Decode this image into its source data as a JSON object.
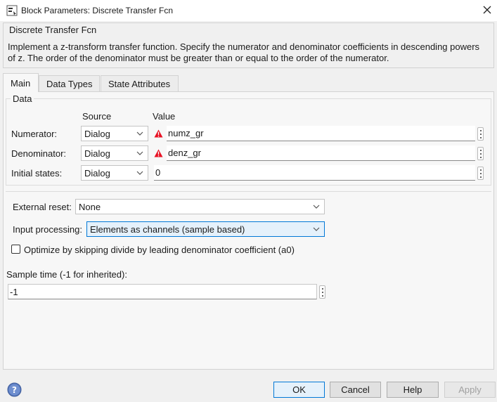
{
  "window": {
    "title": "Block Parameters: Discrete Transfer Fcn",
    "close_icon": "close-icon",
    "app_icon": "block-params-icon"
  },
  "description": {
    "legend": "Discrete Transfer Fcn",
    "text": "Implement a z-transform transfer function. Specify the numerator and denominator coefficients in descending powers of z. The order of the denominator must be greater than or equal to the order of the numerator."
  },
  "tabs": [
    {
      "label": "Main",
      "active": true
    },
    {
      "label": "Data Types",
      "active": false
    },
    {
      "label": "State Attributes",
      "active": false
    }
  ],
  "data_group": {
    "legend": "Data",
    "source_header": "Source",
    "value_header": "Value",
    "rows": [
      {
        "label": "Numerator:",
        "source": "Dialog",
        "value": "numz_gr",
        "warning": true
      },
      {
        "label": "Denominator:",
        "source": "Dialog",
        "value": "denz_gr",
        "warning": true
      },
      {
        "label": "Initial states:",
        "source": "Dialog",
        "value": "0",
        "warning": false
      }
    ]
  },
  "external_reset": {
    "label": "External reset:",
    "value": "None"
  },
  "input_processing": {
    "label": "Input processing:",
    "value": "Elements as channels (sample based)"
  },
  "optimize": {
    "label": "Optimize by skipping divide by leading denominator coefficient (a0)",
    "checked": false
  },
  "sample_time": {
    "label": "Sample time (-1 for inherited):",
    "value": "-1"
  },
  "buttons": {
    "ok": "OK",
    "cancel": "Cancel",
    "help": "Help",
    "apply": "Apply"
  },
  "colors": {
    "accent": "#0078d7",
    "warning": "#e81123",
    "background": "#f0f0f0"
  }
}
